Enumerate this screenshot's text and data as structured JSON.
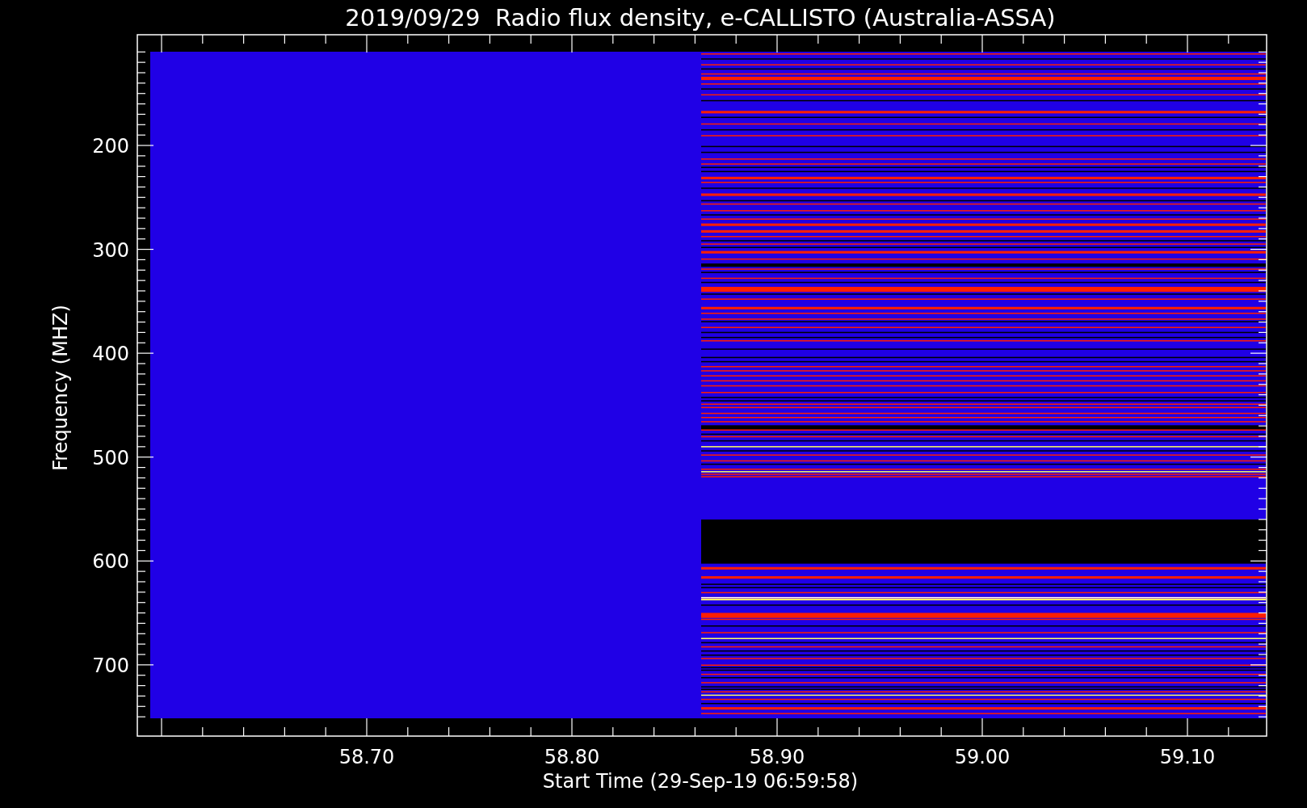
{
  "title": "2019/09/29  Radio flux density, e-CALLISTO (Australia-ASSA)",
  "plot": {
    "x_axis": {
      "title": "Start Time (29-Sep-19 06:59:58)",
      "tick_labels": [
        "58.70",
        "58.80",
        "58.90",
        "59.00",
        "59.10"
      ]
    },
    "y_axis": {
      "title": "Frequency (MHZ)",
      "tick_labels": [
        "200",
        "300",
        "400",
        "500",
        "600",
        "700"
      ]
    }
  }
}
